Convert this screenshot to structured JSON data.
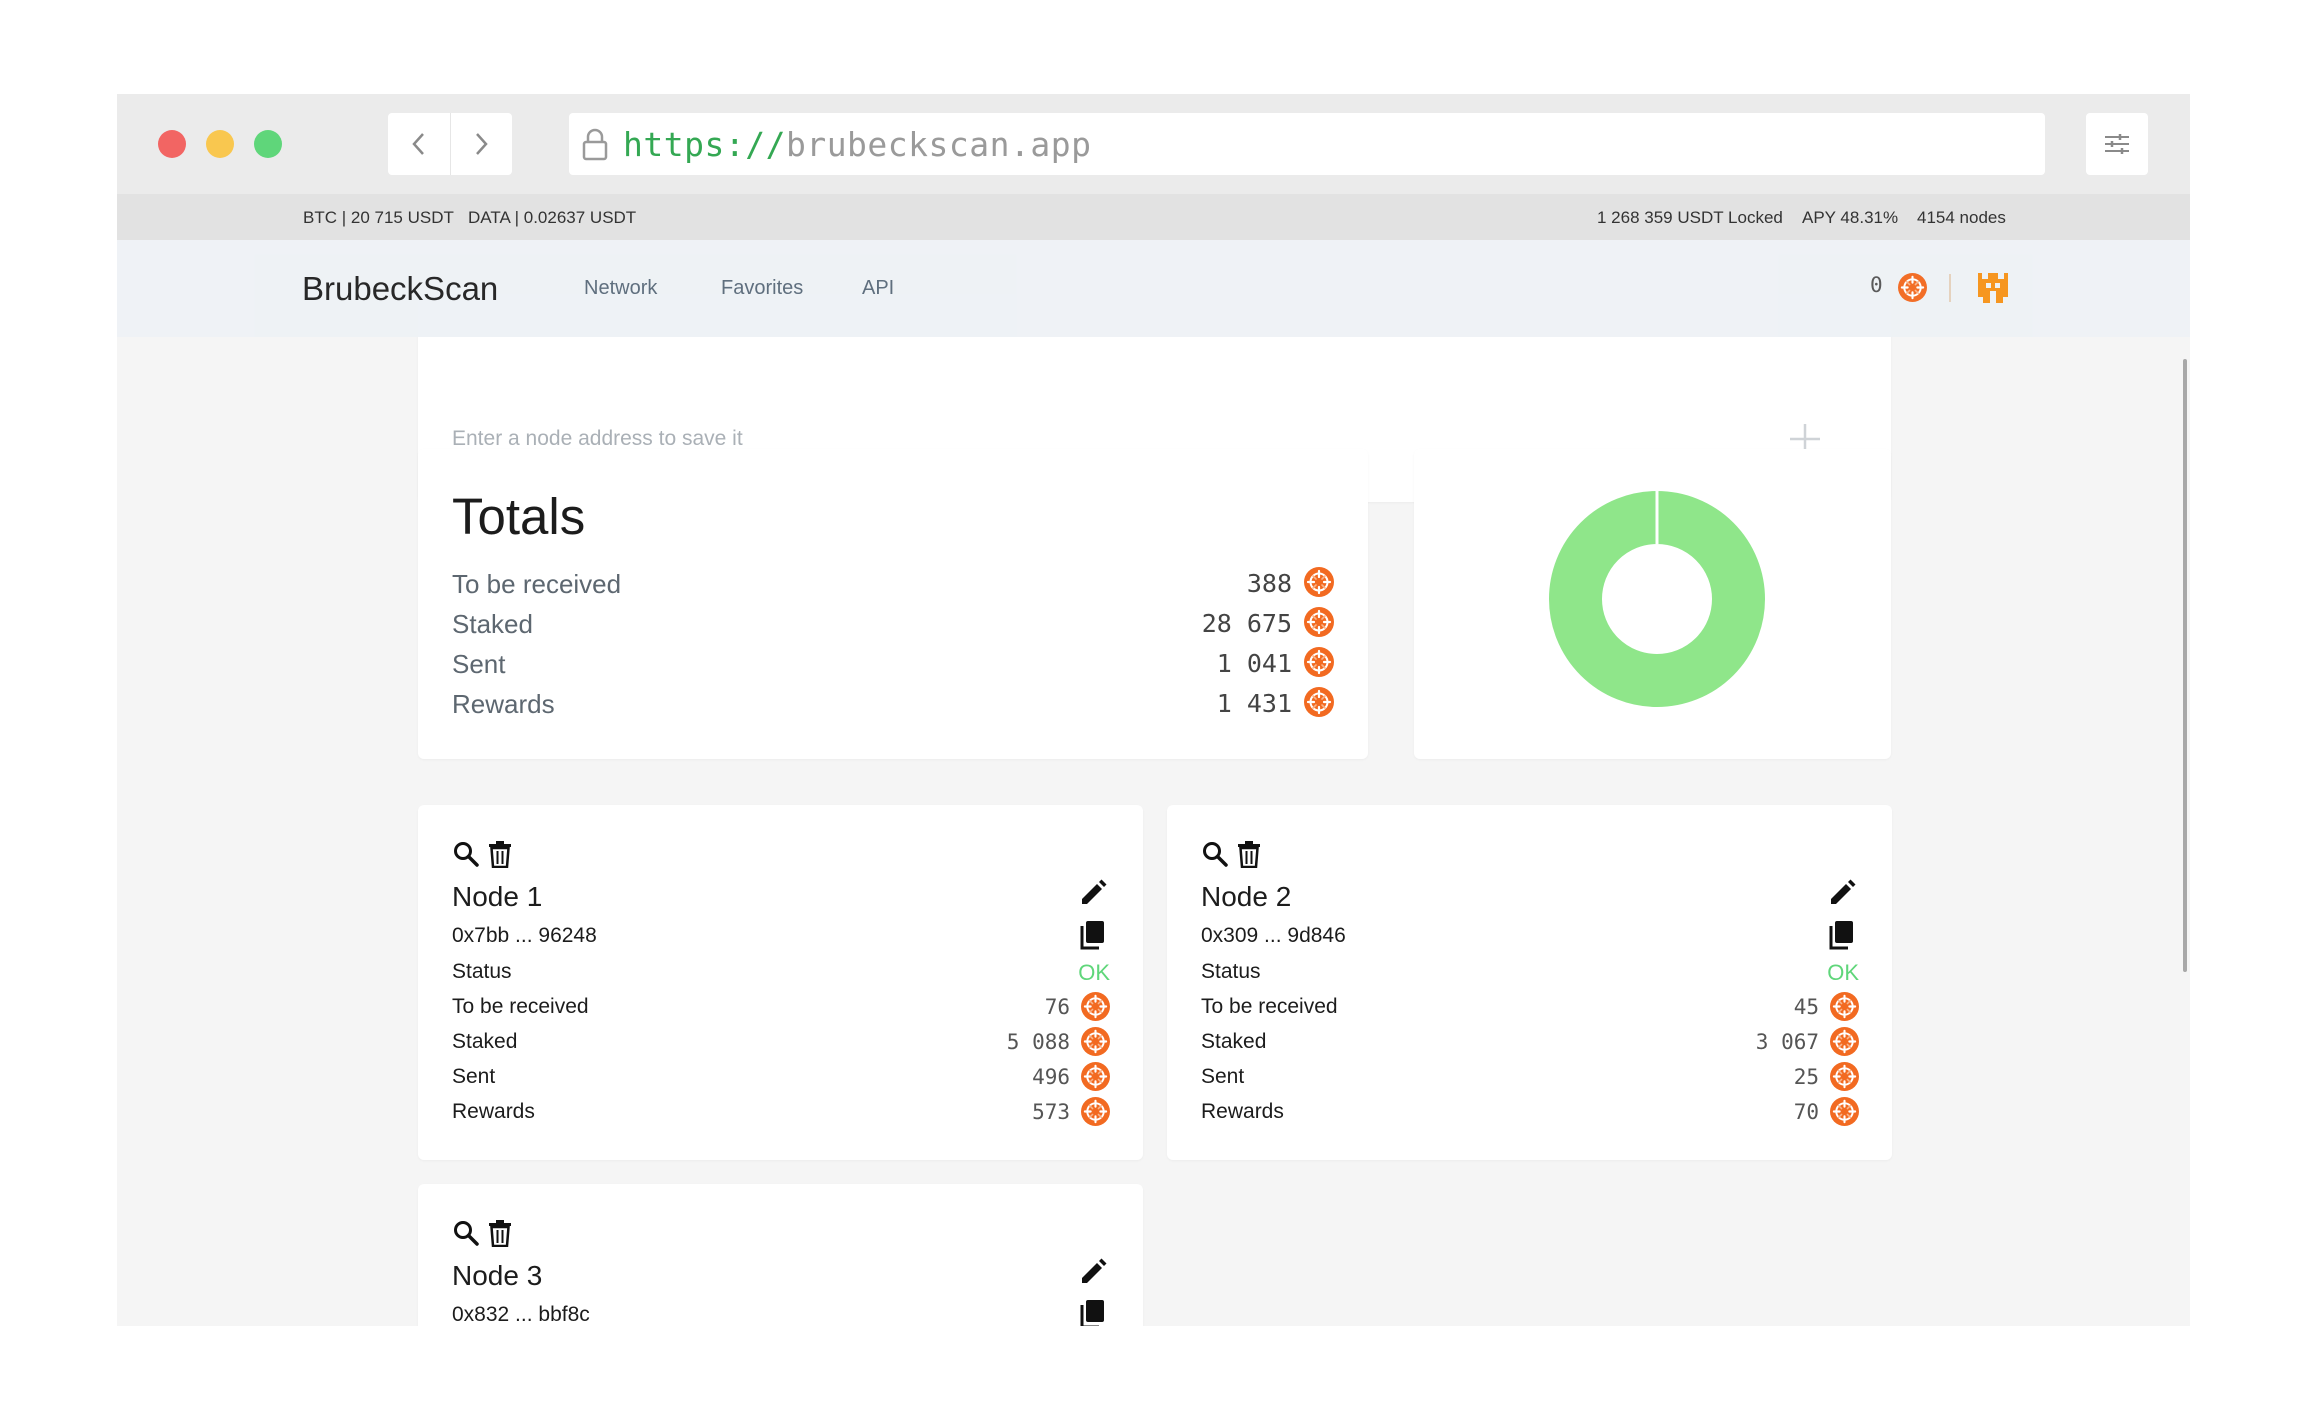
{
  "browser": {
    "url_scheme": "https://",
    "url_host": "brubeckscan.app"
  },
  "ticker": {
    "btc": "BTC | 20 715 USDT",
    "data": "DATA | 0.02637 USDT",
    "locked": "1 268 359 USDT Locked",
    "apy": "APY 48.31%",
    "nodes": "4154 nodes"
  },
  "header": {
    "brand": "BrubeckScan",
    "nav": [
      "Network",
      "Favorites",
      "API"
    ],
    "balance": "0"
  },
  "save_node": {
    "placeholder": "Enter a node address to save it"
  },
  "totals": {
    "title": "Totals",
    "rows": [
      {
        "label": "To be received",
        "value": "388"
      },
      {
        "label": "Staked",
        "value": "28 675"
      },
      {
        "label": "Sent",
        "value": "1 041"
      },
      {
        "label": "Rewards",
        "value": "1 431"
      }
    ]
  },
  "chart_data": {
    "type": "pie",
    "categories": [
      "Staked"
    ],
    "values": [
      100
    ],
    "colors": [
      "#8fe68a"
    ],
    "donut": true
  },
  "nodes": [
    {
      "name": "Node 1",
      "address": "0x7bb ... 96248",
      "status_label": "Status",
      "status": "OK",
      "rows": [
        {
          "label": "To be received",
          "value": "76"
        },
        {
          "label": "Staked",
          "value": "5 088"
        },
        {
          "label": "Sent",
          "value": "496"
        },
        {
          "label": "Rewards",
          "value": "573"
        }
      ]
    },
    {
      "name": "Node 2",
      "address": "0x309 ... 9d846",
      "status_label": "Status",
      "status": "OK",
      "rows": [
        {
          "label": "To be received",
          "value": "45"
        },
        {
          "label": "Staked",
          "value": "3 067"
        },
        {
          "label": "Sent",
          "value": "25"
        },
        {
          "label": "Rewards",
          "value": "70"
        }
      ]
    },
    {
      "name": "Node 3",
      "address": "0x832 ... bbf8c"
    }
  ],
  "colors": {
    "coin": "#f26a21",
    "ok": "#5fd67a",
    "donut": "#8fe68a"
  }
}
